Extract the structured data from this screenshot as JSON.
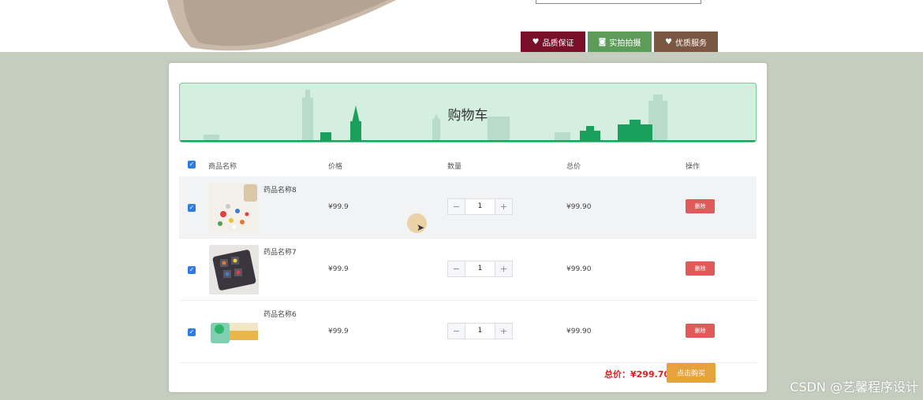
{
  "header": {
    "badges": [
      {
        "icon": "heart-icon",
        "label": "品质保证"
      },
      {
        "icon": "camera-icon",
        "label": "实拍拍摄"
      },
      {
        "icon": "heart-icon",
        "label": "优质服务"
      }
    ]
  },
  "cart": {
    "title": "购物车",
    "columns": {
      "name": "商品名称",
      "price": "价格",
      "qty": "数量",
      "total": "总价",
      "action": "操作"
    },
    "items": [
      {
        "name": "药品名称8",
        "price": "¥99.9",
        "qty": "1",
        "total": "¥99.90",
        "delete": "删除",
        "selected": true
      },
      {
        "name": "药品名称7",
        "price": "¥99.9",
        "qty": "1",
        "total": "¥99.90",
        "delete": "删除",
        "selected": true
      },
      {
        "name": "药品名称6",
        "price": "¥99.9",
        "qty": "1",
        "total": "¥99.90",
        "delete": "删除",
        "selected": true
      }
    ],
    "stepper": {
      "minus": "−",
      "plus": "+"
    },
    "grand_total": "总价：¥299.70",
    "buy_label": "点击购买"
  },
  "watermark": "CSDN @艺馨程序设计",
  "colors": {
    "accent": "#2d7be5",
    "danger": "#e05a5a",
    "buy": "#e6a23c",
    "total": "#e02020"
  }
}
